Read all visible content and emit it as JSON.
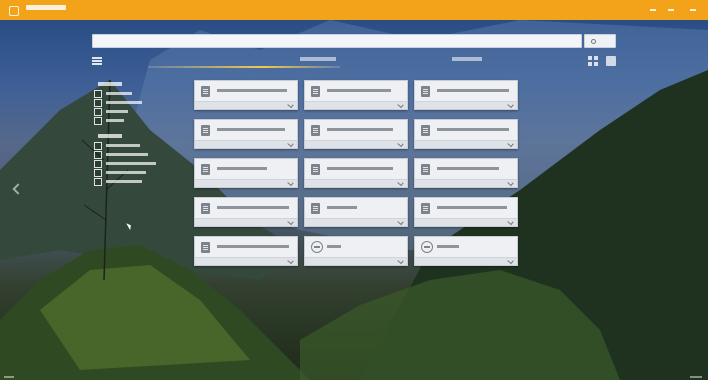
{
  "window": {
    "title": "",
    "controls": [
      "minimize",
      "maximize",
      "close"
    ]
  },
  "search": {
    "value": "",
    "placeholder": "",
    "button_label": ""
  },
  "tabs": [
    {
      "label": "",
      "active": true
    },
    {
      "label": "",
      "active": false
    }
  ],
  "filters": {
    "groups": [
      {
        "heading": "",
        "items": [
          "",
          "",
          "",
          ""
        ]
      },
      {
        "heading": "",
        "items": [
          "",
          "",
          "",
          "",
          "",
          ""
        ]
      }
    ]
  },
  "cards": [
    {
      "label": "",
      "icon": "document-icon"
    },
    {
      "label": "",
      "icon": "document-icon"
    },
    {
      "label": "",
      "icon": "document-icon"
    },
    {
      "label": "",
      "icon": "document-icon"
    },
    {
      "label": "",
      "icon": "document-icon"
    },
    {
      "label": "",
      "icon": "document-icon"
    },
    {
      "label": "",
      "icon": "document-icon"
    },
    {
      "label": "",
      "icon": "document-icon"
    },
    {
      "label": "",
      "icon": "document-icon"
    },
    {
      "label": "",
      "icon": "document-icon"
    },
    {
      "label": "",
      "icon": "document-icon"
    },
    {
      "label": "",
      "icon": "document-icon"
    },
    {
      "label": "",
      "icon": "document-icon"
    },
    {
      "label": "",
      "icon": "circle-icon"
    },
    {
      "label": "",
      "icon": "circle-icon"
    }
  ],
  "colors": {
    "titlebar": "#f2a31a",
    "card": "#eef0f3",
    "tab_underline": "#f2c94c"
  }
}
